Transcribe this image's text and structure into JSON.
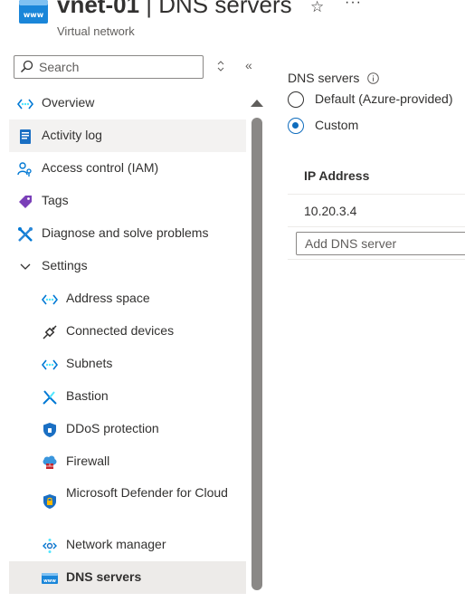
{
  "header": {
    "resource_name": "vnet-01",
    "separator": " | ",
    "page_name": "DNS servers",
    "subtitle": "Virtual network",
    "favorite_icon": "star-icon",
    "more_icon": "more-icon",
    "more_glyph": "···"
  },
  "search": {
    "placeholder": "Search"
  },
  "nav": {
    "collapse_glyph": "«",
    "items": [
      {
        "label": "Overview",
        "icon": "overview-icon"
      },
      {
        "label": "Activity log",
        "icon": "activity-log-icon"
      },
      {
        "label": "Access control (IAM)",
        "icon": "iam-icon"
      },
      {
        "label": "Tags",
        "icon": "tag-icon"
      },
      {
        "label": "Diagnose and solve problems",
        "icon": "wrench-icon"
      },
      {
        "label": "Settings",
        "icon": "chevron-down-icon"
      },
      {
        "label": "Address space",
        "icon": "address-space-icon"
      },
      {
        "label": "Connected devices",
        "icon": "plug-icon"
      },
      {
        "label": "Subnets",
        "icon": "subnet-icon"
      },
      {
        "label": "Bastion",
        "icon": "bastion-icon"
      },
      {
        "label": "DDoS protection",
        "icon": "shield-icon"
      },
      {
        "label": "Firewall",
        "icon": "firewall-icon"
      },
      {
        "label": "Microsoft Defender for Cloud",
        "icon": "defender-icon"
      },
      {
        "label": "Network manager",
        "icon": "network-manager-icon"
      },
      {
        "label": "DNS servers",
        "icon": "dns-icon"
      }
    ]
  },
  "dns": {
    "section_label": "DNS servers",
    "options": [
      {
        "label": "Default (Azure-provided)",
        "selected": false
      },
      {
        "label": "Custom",
        "selected": true
      }
    ],
    "table": {
      "column_header": "IP Address",
      "rows": [
        "10.20.3.4"
      ],
      "add_placeholder": "Add DNS server"
    }
  },
  "colors": {
    "accent": "#0f6cbd",
    "selected_bg": "#edebe9",
    "hover_bg": "#f3f2f1"
  }
}
